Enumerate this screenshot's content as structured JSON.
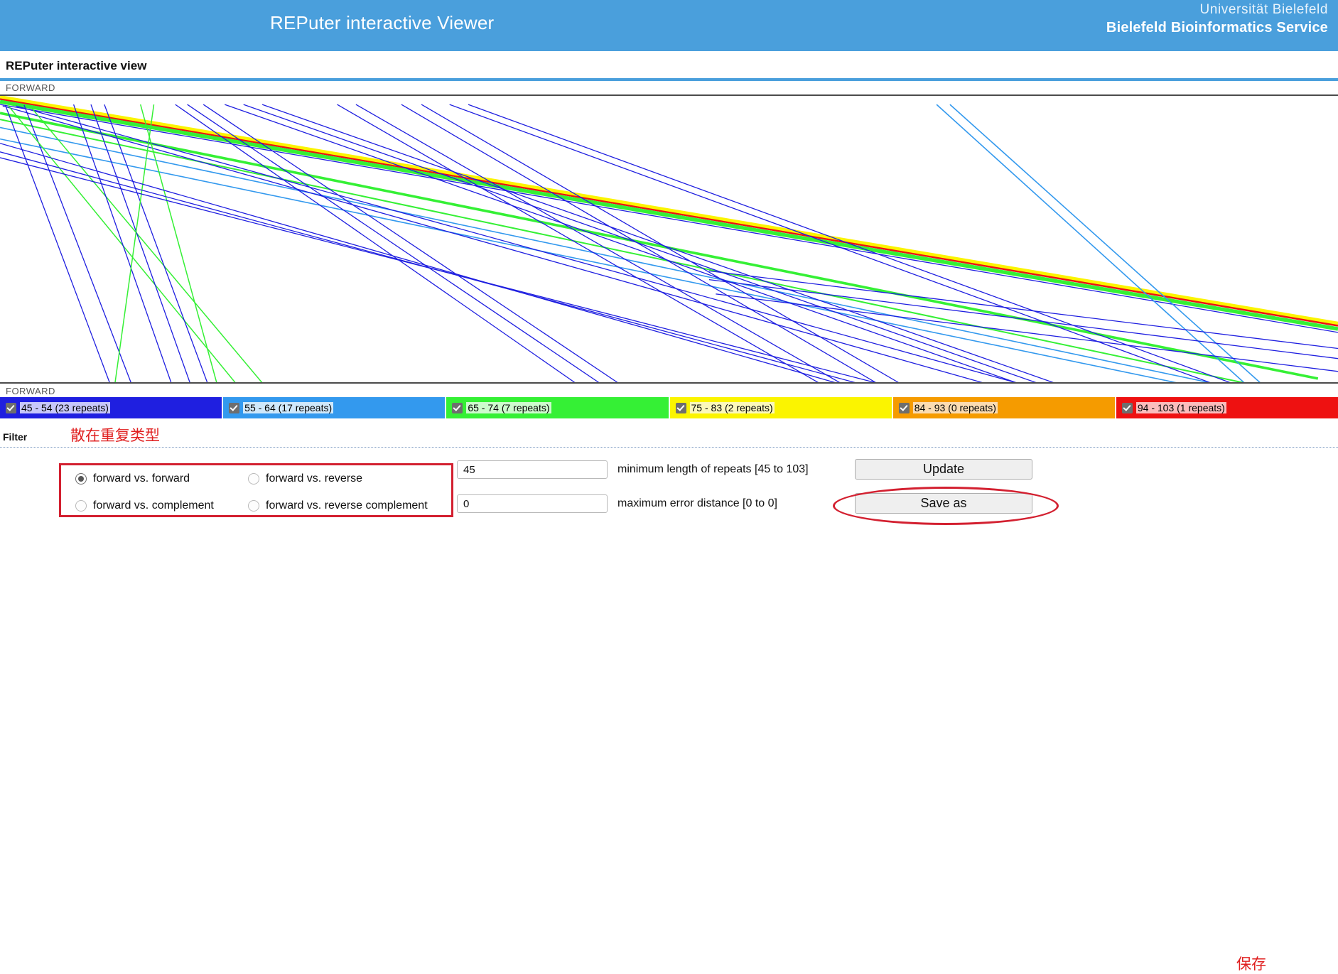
{
  "banner": {
    "title": "REPuter interactive Viewer",
    "university": "Universität Bielefeld",
    "service": "Bielefeld Bioinformatics Service",
    "bg_color": "#4a9fdc"
  },
  "page": {
    "heading": "REPuter interactive view"
  },
  "plot": {
    "top_axis_label": "FORWARD",
    "bottom_axis_label": "FORWARD"
  },
  "legend": {
    "items": [
      {
        "label": "45 - 54 (23 repeats)",
        "color": "#1f1fe0",
        "text_bg": "#c7c7fb",
        "checked": true
      },
      {
        "label": "55 - 64 (17 repeats)",
        "color": "#3399ee",
        "text_bg": "#cfe8fb",
        "checked": true
      },
      {
        "label": "65 - 74 (7 repeats)",
        "color": "#35f035",
        "text_bg": "#cdfbcd",
        "checked": true
      },
      {
        "label": "75 - 83 (2 repeats)",
        "color": "#fbf400",
        "text_bg": "#fbf8bb",
        "checked": true
      },
      {
        "label": "84 - 93 (0 repeats)",
        "color": "#f59b00",
        "text_bg": "#fbdcb2",
        "checked": true
      },
      {
        "label": "94 - 103 (1 repeats)",
        "color": "#ee1111",
        "text_bg": "#fbbcbc",
        "checked": true
      }
    ]
  },
  "filter": {
    "label": "Filter",
    "annotation_type": "散在重复类型",
    "annotation_save": "保存",
    "radios": [
      {
        "label": "forward vs. forward",
        "selected": true
      },
      {
        "label": "forward vs. reverse",
        "selected": false
      },
      {
        "label": "forward vs. complement",
        "selected": false
      },
      {
        "label": "forward vs. reverse complement",
        "selected": false
      }
    ],
    "min_length": {
      "value": "45",
      "caption": "minimum length of repeats [45 to 103]"
    },
    "max_error": {
      "value": "0",
      "caption": "maximum error distance [0 to 0]"
    },
    "update_button": "Update",
    "save_as_button": "Save as"
  },
  "chart_data": {
    "type": "scatter",
    "title": "REPuter interactive view",
    "xlabel": "FORWARD",
    "ylabel": "FORWARD",
    "grid": false,
    "legend_position": "bottom",
    "description": "Repeat dot-plot: each repeat pair drawn as a colored line segment from (x1,y1) to (x2,y2) in normalized 0-1 plot coordinates. Color encodes the repeat-length class from the legend.",
    "color_classes": [
      {
        "range": "45 - 54",
        "repeats": 23,
        "color": "#1f1fe0"
      },
      {
        "range": "55 - 64",
        "repeats": 17,
        "color": "#3399ee"
      },
      {
        "range": "65 - 74",
        "repeats": 7,
        "color": "#35f035"
      },
      {
        "range": "75 - 83",
        "repeats": 2,
        "color": "#fbf400"
      },
      {
        "range": "84 - 93",
        "repeats": 0,
        "color": "#f59b00"
      },
      {
        "range": "94 - 103",
        "repeats": 1,
        "color": "#ee1111"
      }
    ],
    "segments": [
      {
        "x1": 0.0,
        "y1": 0.01,
        "x2": 1.0,
        "y2": 0.8,
        "color": "#ee1111",
        "w": 3.2
      },
      {
        "x1": 0.0,
        "y1": 0.003,
        "x2": 1.0,
        "y2": 0.792,
        "color": "#fbf400",
        "w": 4.4
      },
      {
        "x1": 0.0,
        "y1": 0.02,
        "x2": 1.0,
        "y2": 0.812,
        "color": "#35f035",
        "w": 5.4
      },
      {
        "x1": 0.0,
        "y1": 0.03,
        "x2": 1.0,
        "y2": 0.824,
        "color": "#1f1fe0",
        "w": 1.3
      },
      {
        "x1": 0.0,
        "y1": 0.06,
        "x2": 0.985,
        "y2": 0.985,
        "color": "#35f035",
        "w": 3.6
      },
      {
        "x1": 0.0,
        "y1": 0.082,
        "x2": 0.93,
        "y2": 1.0,
        "color": "#35f035",
        "w": 2.0
      },
      {
        "x1": 0.0,
        "y1": 0.11,
        "x2": 0.905,
        "y2": 1.0,
        "color": "#3399ee",
        "w": 1.6
      },
      {
        "x1": 0.0,
        "y1": 0.15,
        "x2": 0.88,
        "y2": 1.0,
        "color": "#3399ee",
        "w": 1.6
      },
      {
        "x1": 0.002,
        "y1": 0.035,
        "x2": 0.735,
        "y2": 1.0,
        "color": "#1f1fe0",
        "w": 1.3
      },
      {
        "x1": 0.012,
        "y1": 0.035,
        "x2": 0.76,
        "y2": 1.0,
        "color": "#1f1fe0",
        "w": 1.3
      },
      {
        "x1": 0.004,
        "y1": 0.032,
        "x2": 0.082,
        "y2": 1.0,
        "color": "#1f1fe0",
        "w": 1.3
      },
      {
        "x1": 0.018,
        "y1": 0.032,
        "x2": 0.098,
        "y2": 1.0,
        "color": "#1f1fe0",
        "w": 1.3
      },
      {
        "x1": 0.006,
        "y1": 0.033,
        "x2": 0.176,
        "y2": 1.0,
        "color": "#35f035",
        "w": 1.5
      },
      {
        "x1": 0.022,
        "y1": 0.033,
        "x2": 0.196,
        "y2": 1.0,
        "color": "#35f035",
        "w": 1.5
      },
      {
        "x1": 0.055,
        "y1": 0.03,
        "x2": 0.128,
        "y2": 1.0,
        "color": "#1f1fe0",
        "w": 1.3
      },
      {
        "x1": 0.068,
        "y1": 0.03,
        "x2": 0.142,
        "y2": 1.0,
        "color": "#1f1fe0",
        "w": 1.3
      },
      {
        "x1": 0.078,
        "y1": 0.03,
        "x2": 0.155,
        "y2": 1.0,
        "color": "#1f1fe0",
        "w": 1.3
      },
      {
        "x1": 0.105,
        "y1": 0.03,
        "x2": 0.162,
        "y2": 1.0,
        "color": "#35f035",
        "w": 1.5
      },
      {
        "x1": 0.115,
        "y1": 0.03,
        "x2": 0.086,
        "y2": 1.0,
        "color": "#35f035",
        "w": 1.5
      },
      {
        "x1": 0.131,
        "y1": 0.03,
        "x2": 0.43,
        "y2": 1.0,
        "color": "#1f1fe0",
        "w": 1.3
      },
      {
        "x1": 0.14,
        "y1": 0.03,
        "x2": 0.448,
        "y2": 1.0,
        "color": "#1f1fe0",
        "w": 1.3
      },
      {
        "x1": 0.152,
        "y1": 0.03,
        "x2": 0.462,
        "y2": 1.0,
        "color": "#1f1fe0",
        "w": 1.3
      },
      {
        "x1": 0.168,
        "y1": 0.03,
        "x2": 0.76,
        "y2": 1.0,
        "color": "#1f1fe0",
        "w": 1.3
      },
      {
        "x1": 0.182,
        "y1": 0.03,
        "x2": 0.775,
        "y2": 1.0,
        "color": "#1f1fe0",
        "w": 1.3
      },
      {
        "x1": 0.196,
        "y1": 0.03,
        "x2": 0.788,
        "y2": 1.0,
        "color": "#1f1fe0",
        "w": 1.3
      },
      {
        "x1": 0.252,
        "y1": 0.03,
        "x2": 0.612,
        "y2": 1.0,
        "color": "#1f1fe0",
        "w": 1.3
      },
      {
        "x1": 0.266,
        "y1": 0.03,
        "x2": 0.628,
        "y2": 1.0,
        "color": "#1f1fe0",
        "w": 1.3
      },
      {
        "x1": 0.3,
        "y1": 0.03,
        "x2": 0.655,
        "y2": 1.0,
        "color": "#1f1fe0",
        "w": 1.3
      },
      {
        "x1": 0.315,
        "y1": 0.03,
        "x2": 0.672,
        "y2": 1.0,
        "color": "#1f1fe0",
        "w": 1.3
      },
      {
        "x1": 0.336,
        "y1": 0.03,
        "x2": 0.905,
        "y2": 1.0,
        "color": "#1f1fe0",
        "w": 1.3
      },
      {
        "x1": 0.35,
        "y1": 0.03,
        "x2": 0.92,
        "y2": 1.0,
        "color": "#1f1fe0",
        "w": 1.3
      },
      {
        "x1": 0.7,
        "y1": 0.03,
        "x2": 0.93,
        "y2": 1.0,
        "color": "#3399ee",
        "w": 1.6
      },
      {
        "x1": 0.71,
        "y1": 0.03,
        "x2": 0.942,
        "y2": 1.0,
        "color": "#3399ee",
        "w": 1.6
      },
      {
        "x1": 0.0,
        "y1": 0.165,
        "x2": 0.625,
        "y2": 1.0,
        "color": "#1f1fe0",
        "w": 1.3
      },
      {
        "x1": 0.0,
        "y1": 0.195,
        "x2": 0.64,
        "y2": 1.0,
        "color": "#1f1fe0",
        "w": 1.3
      },
      {
        "x1": 0.0,
        "y1": 0.215,
        "x2": 0.655,
        "y2": 1.0,
        "color": "#1f1fe0",
        "w": 1.3
      },
      {
        "x1": 0.53,
        "y1": 0.61,
        "x2": 1.0,
        "y2": 0.88,
        "color": "#1f1fe0",
        "w": 1.3
      },
      {
        "x1": 0.53,
        "y1": 0.64,
        "x2": 1.0,
        "y2": 0.915,
        "color": "#1f1fe0",
        "w": 1.3
      },
      {
        "x1": 0.535,
        "y1": 0.69,
        "x2": 1.0,
        "y2": 0.96,
        "color": "#1f1fe0",
        "w": 1.3
      }
    ]
  }
}
